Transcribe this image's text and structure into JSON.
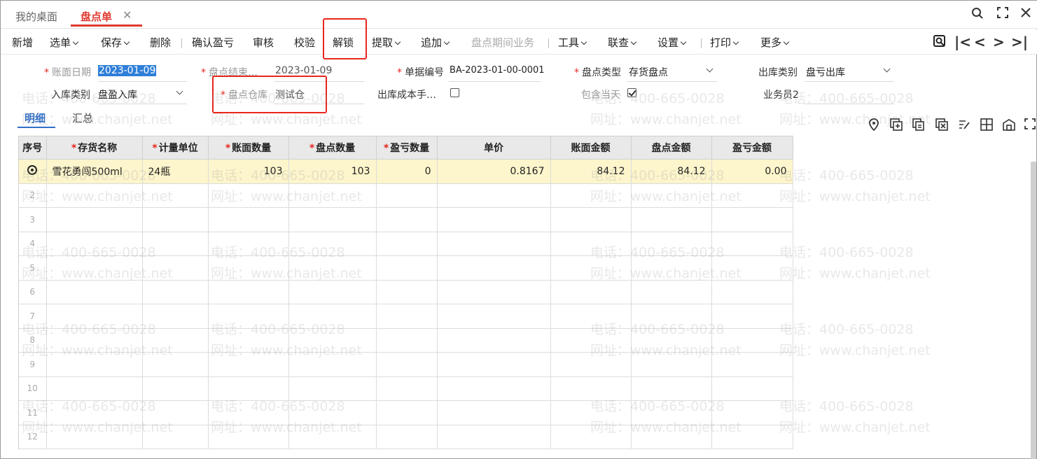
{
  "tabs": {
    "home": "我的桌面",
    "active": "盘点单",
    "close": "✕"
  },
  "window_icons": [
    "search-icon",
    "fullscreen-icon",
    "close-icon"
  ],
  "toolbar": {
    "new": "新增",
    "select": "选单",
    "save": "保存",
    "delete": "删除",
    "confirm": "确认盈亏",
    "review": "审核",
    "verify": "校验",
    "unlock": "解锁",
    "extract": "提取",
    "append": "追加",
    "period_business": "盘点期间业务",
    "tools": "工具",
    "query": "联查",
    "settings": "设置",
    "print": "打印",
    "more": "更多"
  },
  "nav": {
    "first": "|<",
    "prev": "<",
    "next": ">",
    "last": ">|"
  },
  "form": {
    "book_date_label": "账面日期",
    "book_date_value": "2023-01-09",
    "count_end_label": "盘点结束…",
    "count_end_value": "2023-01-09",
    "doc_no_label": "单据编号",
    "doc_no_value": "BA-2023-01-00-0001",
    "count_type_label": "盘点类型",
    "count_type_value": "存货盘点",
    "out_type_label": "出库类别",
    "out_type_value": "盘亏出库",
    "in_type_label": "入库类别",
    "in_type_value": "盘盈入库",
    "warehouse_label": "盘点仓库",
    "warehouse_value": "测试仓",
    "out_cost_label": "出库成本手…",
    "include_today_label": "包含当天",
    "salesman_label": "业务员2"
  },
  "subtabs": {
    "detail": "明细",
    "summary": "汇总"
  },
  "grid": {
    "headers": {
      "index": "序号",
      "name": "存货名称",
      "unit": "计量单位",
      "book_qty": "账面数量",
      "count_qty": "盘点数量",
      "diff_qty": "盈亏数量",
      "price": "单价",
      "book_amt": "账面金额",
      "count_amt": "盘点金额",
      "diff_amt": "盈亏金额"
    },
    "row1": {
      "name": "雪花勇闯500ml",
      "unit": "24瓶",
      "book_qty": "103",
      "count_qty": "103",
      "diff_qty": "0",
      "price": "0.8167",
      "book_amt": "84.12",
      "count_amt": "84.12",
      "diff_amt": "0.00"
    },
    "row_numbers": [
      "2",
      "3",
      "4",
      "5",
      "6",
      "7",
      "8",
      "9",
      "10",
      "11",
      "12"
    ]
  },
  "watermark": {
    "line1": "电话：400-665-0028",
    "line2": "网址：www.chanjet.net"
  }
}
